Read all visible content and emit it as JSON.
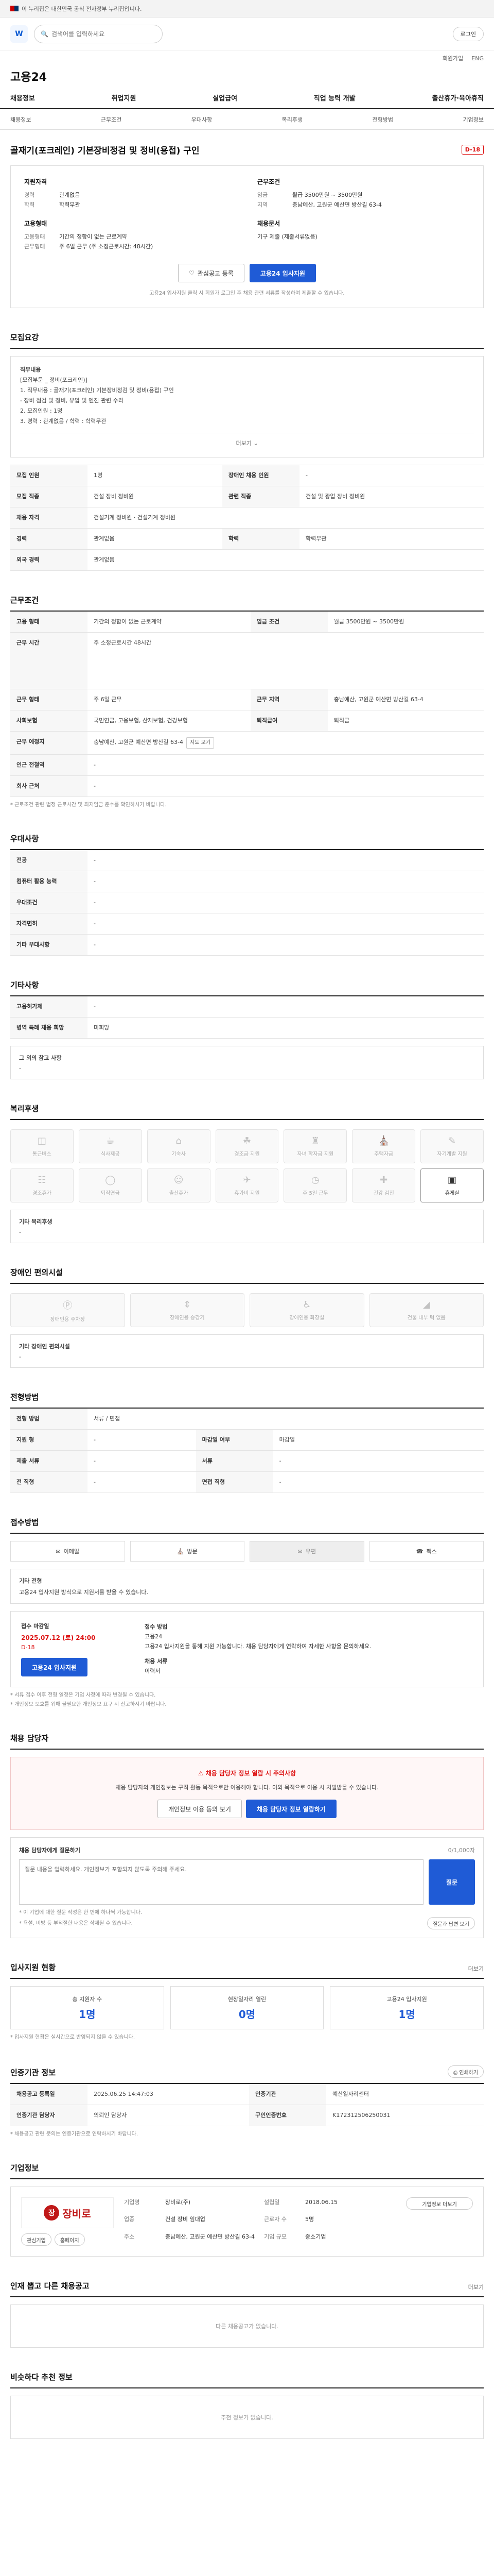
{
  "gov_banner": {
    "text": "이 누리집은 대한민국 공식 전자정부 누리집입니다."
  },
  "header": {
    "logo_text": "W",
    "search_placeholder": "검색어를 입력하세요",
    "login_label": "로그인",
    "util_links": [
      "회원가입",
      "ENG"
    ],
    "brand": "고용24"
  },
  "gnb": [
    "채용정보",
    "취업지원",
    "실업급여",
    "직업 능력 개발",
    "출산휴가·육아휴직"
  ],
  "subnav": [
    "채용정보",
    "근무조건",
    "우대사항",
    "복리후생",
    "전형방법",
    "기업정보"
  ],
  "job": {
    "title": "골재기(포크레인) 기본장비정검 및 정비(용접) 구인",
    "dday": "D-18"
  },
  "summary": {
    "left_blocks": [
      {
        "title": "지원자격",
        "rows": [
          {
            "k": "경력",
            "v": "관계없음"
          },
          {
            "k": "학력",
            "v": "학력무관"
          }
        ]
      },
      {
        "title": "고용형태",
        "rows": [
          {
            "k": "고용형태",
            "v": "기간의 정함이 없는 근로계약"
          },
          {
            "k": "근무형태",
            "v": "주 6일 근무 (주 소정근로시간: 48시간)"
          }
        ]
      }
    ],
    "right_blocks": [
      {
        "title": "근무조건",
        "rows": [
          {
            "k": "임금",
            "v": "월급 3500만원 ~ 3500만원"
          },
          {
            "k": "지역",
            "v": "충남예산, 고원군 예산면 방산길 63-4"
          }
        ]
      },
      {
        "title": "채용문서",
        "rows": [
          {
            "k": "",
            "v": "기구 제출 (제출서류없음)"
          }
        ]
      }
    ],
    "bookmark_label": "관심공고 등록",
    "apply_label": "고용24 입사지원",
    "notice": "고용24 입사지원 클릭 시 회원가 로그인 후 채용 관련 서류를 작성하여 제출할 수 있습니다."
  },
  "recruit": {
    "title": "모집요강",
    "desc_title": "직무내용",
    "desc_lines": [
      "[모집부문 _ 정비(포크레인)]",
      "1. 직무내용 : 골재기(포크레인) 기본장비정검 및 정비(용접) 구인",
      "- 장비 점검 및 정비, 유압 및 엔진 관련 수리",
      "2. 모집인원 : 1명",
      "3. 경력 : 관계없음 / 학력 : 학력무관"
    ],
    "more_label": "더보기",
    "rows": [
      {
        "k": "모집 인원",
        "v": "1명",
        "k2": "장애인 채용 인원",
        "v2": "-"
      },
      {
        "k": "모집 직종",
        "v": "건설 장비 정비원",
        "k2": "관련 직종",
        "v2": "건설 및 광업 장비 정비원"
      },
      {
        "k": "채용 자격",
        "v": "건설기계 정비원 · 건설기계 정비원",
        "k2": "",
        "v2": ""
      },
      {
        "k": "경력",
        "v": "관계없음",
        "k2": "학력",
        "v2": "학력무관"
      },
      {
        "k": "외국 경력",
        "v": "관계없음",
        "k2": "",
        "v2": ""
      }
    ]
  },
  "conditions": {
    "title": "근무조건",
    "rows": [
      {
        "k": "고용 형태",
        "v": "기간의 정함이 없는 근로계약",
        "k2": "임금 조건",
        "v2": "월급 3500만원 ~ 3500만원"
      },
      {
        "k": "근무 시간",
        "v": "주 소정근로시간 48시간",
        "k2": "",
        "v2": ""
      },
      {
        "k": "근무 형태",
        "v": "주 6일 근무",
        "k2": "근무 지역",
        "v2": "충남예산, 고원군 예산면 방산길 63-4"
      },
      {
        "k": "사회보험",
        "v": "국민연금, 고용보험, 산재보험, 건강보험",
        "k2": "퇴직급여",
        "v2": "퇴직금"
      },
      {
        "k": "근무 예정지",
        "v": "충남예산, 고원군 예산면 방산길 63-4",
        "k2": "",
        "v2": ""
      },
      {
        "k": "인근 전철역",
        "v": "-",
        "k2": "",
        "v2": ""
      },
      {
        "k": "회사 근처",
        "v": "-",
        "k2": "",
        "v2": ""
      }
    ],
    "map_label": "지도 보기",
    "note": "* 근로조건 관련 법정 근로시간 및 최저임금 준수를 확인하시기 바랍니다."
  },
  "preferences": {
    "title": "우대사항",
    "rows": [
      {
        "k": "전공",
        "v": "-"
      },
      {
        "k": "컴퓨터 활용 능력",
        "v": "-"
      },
      {
        "k": "우대조건",
        "v": "-"
      },
      {
        "k": "자격면허",
        "v": "-"
      },
      {
        "k": "기타 우대사항",
        "v": "-"
      }
    ]
  },
  "others": {
    "title": "기타사항",
    "rows": [
      {
        "k": "고용허가제",
        "v": "-"
      },
      {
        "k": "병역 특례 채용 희망",
        "v": "미희망"
      }
    ],
    "extra_label": "그 외의 참고 사항",
    "extra_value": "-"
  },
  "welfare": {
    "title": "복리후생",
    "tiles": [
      "통근버스",
      "식사제공",
      "기숙사",
      "경조금 지원",
      "자녀 학자금 지원",
      "주택자금",
      "자기계발 지원",
      "경조휴가",
      "퇴직연금",
      "출산휴가",
      "휴가비 지원",
      "주 5일 근무",
      "건강 검진",
      "휴게실"
    ],
    "active_index": 13,
    "other_label": "기타 복리후생",
    "other_value": "-"
  },
  "disability": {
    "title": "장애인 편의시설",
    "tiles": [
      "장애인용 주차장",
      "장애인용 승강기",
      "장애인용 화장실",
      "건물 내부 턱 없음"
    ],
    "other_label": "기타 장애인 편의시설",
    "other_value": "-"
  },
  "selection": {
    "title": "전형방법",
    "rows": [
      {
        "k": "전형 방법",
        "v": "서류 / 면접",
        "k2": "",
        "v2": ""
      },
      {
        "k": "지원 형",
        "v": "-",
        "k2": "마감일 여부",
        "v2": "마감일"
      },
      {
        "k": "제출 서류",
        "v": "-",
        "k2": "서류",
        "v2": "-"
      },
      {
        "k": "전 직형",
        "v": "-",
        "k2": "면접 직형",
        "v2": "-"
      }
    ]
  },
  "apply_method": {
    "title": "접수방법",
    "methods": [
      "이메일",
      "방문",
      "우편",
      "팩스"
    ],
    "active_index": 2,
    "other_label": "기타 전형",
    "other_value": "고용24 입사지원 방식으로 지원서를 받을 수 있습니다.",
    "deadline_label": "접수 마감일",
    "deadline_date": "2025.07.12 (토) 24:00",
    "deadline_sub": "D-18",
    "apply_label": "고용24 입사지원",
    "method_label": "접수 방법",
    "method_value": "고용24",
    "method_desc": "고용24 입사지원을 통해 지원 가능합니다. 채용 담당자에게 연락하여 자세한 사항을 문의하세요.",
    "contact_label": "채용 서류",
    "contact_value": "이력서",
    "notes": [
      "* 서류 접수 이후 전형 일정은 기업 사정에 따라 변경될 수 있습니다.",
      "* 개인정보 보호를 위해 불필요한 개인정보 요구 시 신고하시기 바랍니다."
    ]
  },
  "contact": {
    "title": "채용 담당자",
    "warn_title": "채용 담당자 정보 열람 시 주의사항",
    "warn_text": "채용 담당자의 개인정보는 구직 활동 목적으로만 이용해야 합니다. 이외 목적으로 이용 시 처벌받을 수 있습니다.",
    "btn_view": "개인정보 이용 동의 보기",
    "btn_confirm": "채용 담당자 정보 열람하기"
  },
  "qa": {
    "title": "채용 담당자에게 질문하기",
    "counter": "0/1,000자",
    "placeholder": "질문 내용을 입력하세요. 개인정보가 포함되지 않도록 주의해 주세요.",
    "submit_label": "질문",
    "notes": [
      "* 이 기업에 대한 질문 작성은 한 번에 하나씩 가능합니다.",
      "* 욕설, 비방 등 부적절한 내용은 삭제될 수 있습니다."
    ],
    "more_label": "질문과 답변 보기"
  },
  "stats": {
    "title": "입사지원 현황",
    "more_label": "더보기",
    "items": [
      {
        "label": "총 지원자 수",
        "value": "1명"
      },
      {
        "label": "현장일자리 열린",
        "value": "0명"
      },
      {
        "label": "고용24 입사지원",
        "value": "1명"
      }
    ],
    "note": "* 입사지원 현황은 실시간으로 반영되지 않을 수 있습니다."
  },
  "jobinfo": {
    "title": "인증기관 정보",
    "print_label": "인쇄하기",
    "rows": [
      {
        "k": "채용공고 등록일",
        "v": "2025.06.25 14:47:03",
        "k2": "인증기관",
        "v2": "예산일자리센터"
      },
      {
        "k": "인증기관 담당자",
        "v": "의뢰인 담당자",
        "k2": "구인인증번호",
        "v2": "K172312506250031"
      }
    ],
    "note": "* 채용공고 관련 문의는 인증기관으로 연락하시기 바랍니다."
  },
  "company": {
    "title": "기업정보",
    "logo_text": "장비로",
    "logo_mark": "장",
    "rows": [
      {
        "k": "기업명",
        "v": "장비로(주)"
      },
      {
        "k": "설립일",
        "v": "2018.06.15"
      },
      {
        "k": "업종",
        "v": "건설 장비 임대업"
      },
      {
        "k": "근로자 수",
        "v": "5명"
      },
      {
        "k": "주소",
        "v": "충남예산, 고원군 예산면 방산길 63-4"
      },
      {
        "k": "기업 규모",
        "v": "중소기업"
      }
    ],
    "btn_bookmark": "관심기업",
    "btn_home": "홈페이지",
    "btn_more": "기업정보 더보기"
  },
  "company_jobs": {
    "title": "인재 뽑고 다른 채용공고",
    "more_label": "더보기",
    "empty": "다른 채용공고가 없습니다."
  },
  "recommend": {
    "title": "비슷하다 추천 정보",
    "empty": "추천 정보가 없습니다."
  }
}
